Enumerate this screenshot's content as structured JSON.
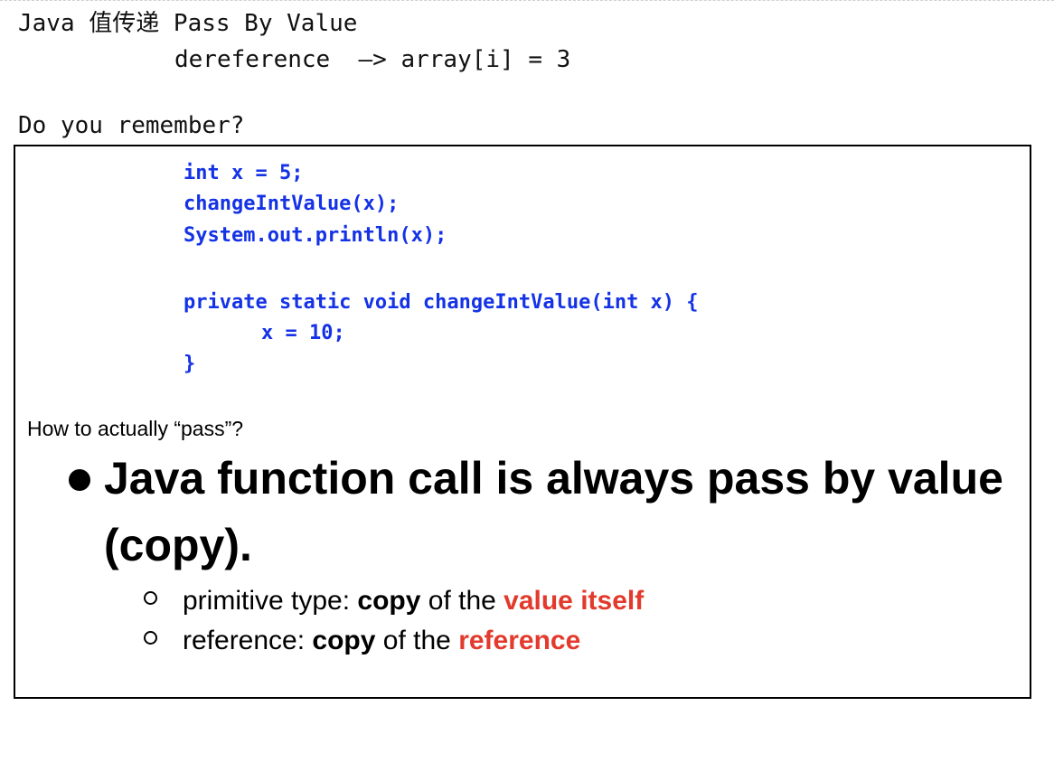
{
  "header": {
    "title": "Java 值传递 Pass By Value",
    "deref_line": "dereference  —> array[i] = 3",
    "remember": "Do you remember?"
  },
  "slide": {
    "code_lines": [
      "int x = 5;",
      "changeIntValue(x);",
      "System.out.println(x);",
      "private static void changeIntValue(int x) {",
      "x = 10;",
      "}"
    ],
    "question": "How to actually “pass”?",
    "main_bullet": "Java function call is always pass by value (copy).",
    "sub_bullets": [
      {
        "prefix": "primitive type: ",
        "bold": "copy",
        "middle": " of the ",
        "highlight": "value itself"
      },
      {
        "prefix": "reference: ",
        "bold": "copy",
        "middle": " of the ",
        "highlight": "reference"
      }
    ]
  },
  "colors": {
    "code": "#1432e6",
    "highlight": "#e23a2c"
  }
}
